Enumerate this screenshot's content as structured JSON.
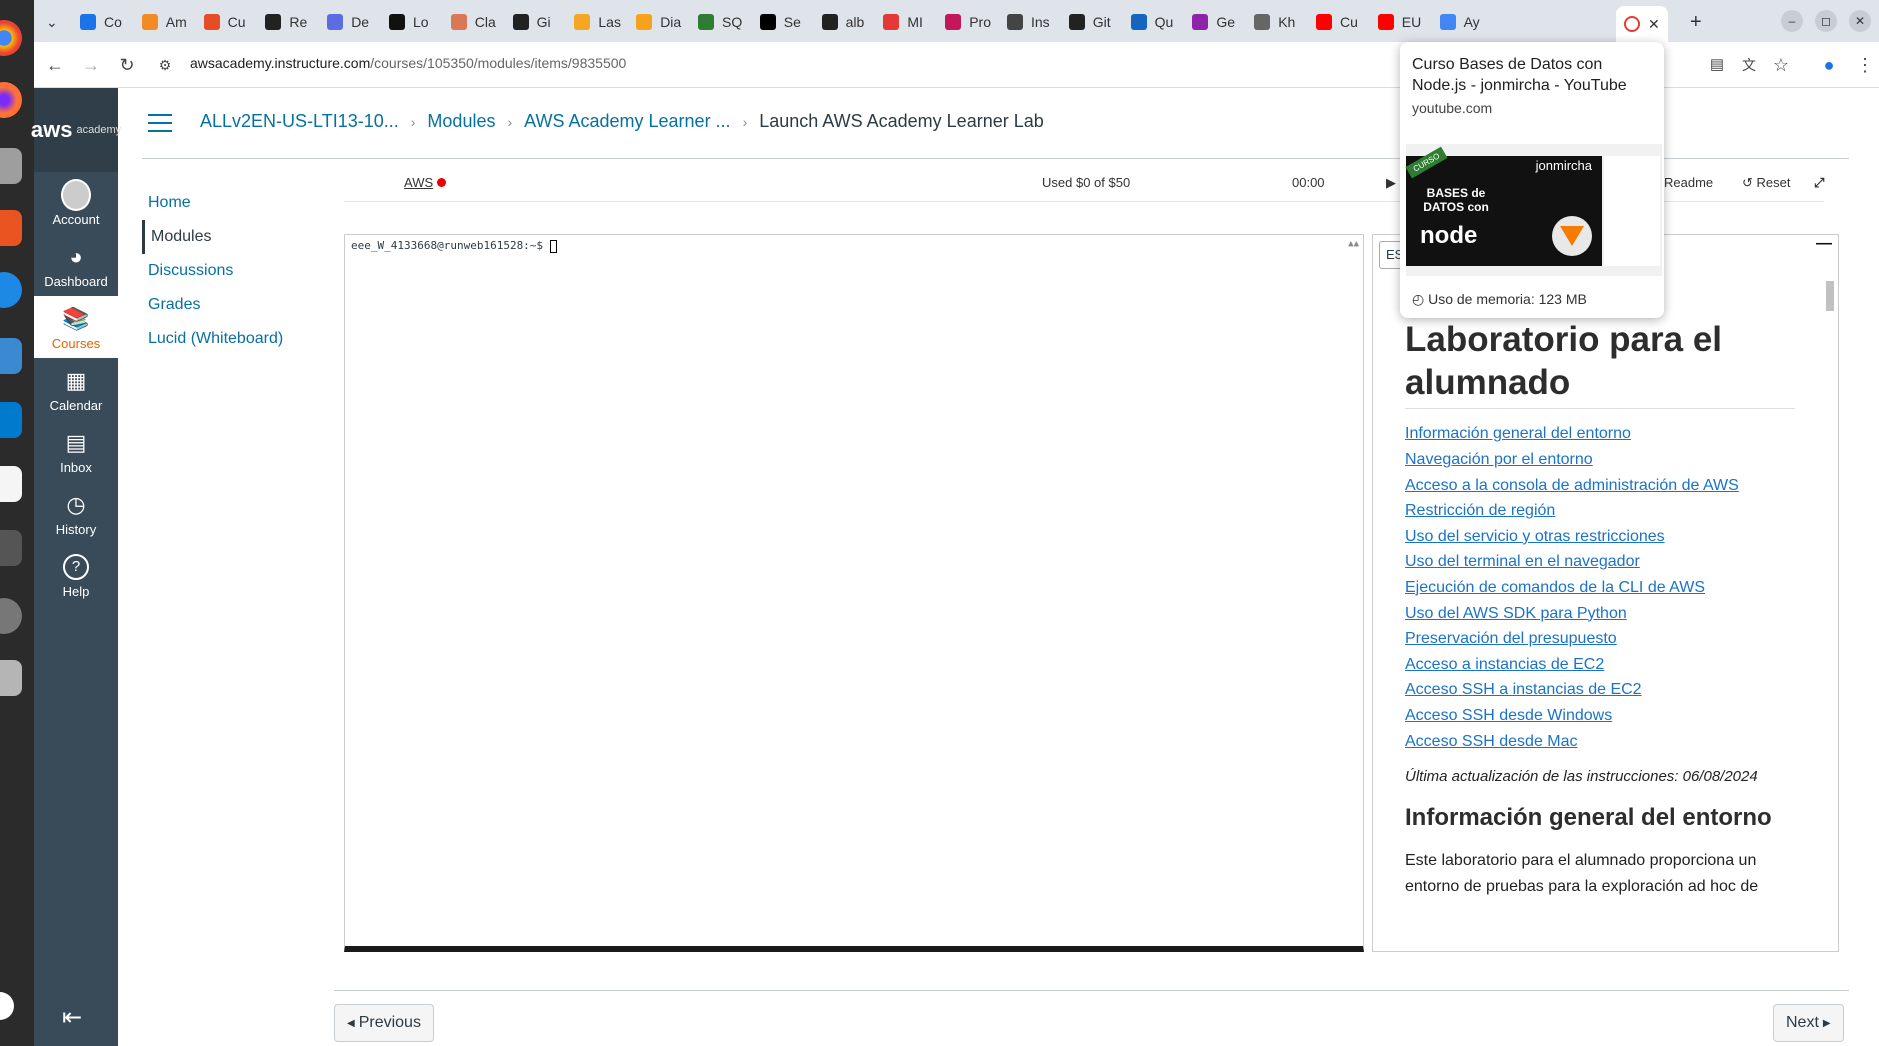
{
  "browser": {
    "tabs": [
      {
        "label": "Co",
        "color": "#1a73e8"
      },
      {
        "label": "Am",
        "color": "#f28b24"
      },
      {
        "label": "Cu",
        "color": "#e44d26"
      },
      {
        "label": "Re",
        "color": "#222222"
      },
      {
        "label": "De",
        "color": "#5b6ee1"
      },
      {
        "label": "Lo",
        "color": "#111111"
      },
      {
        "label": "Cla",
        "color": "#d97757"
      },
      {
        "label": "Gi",
        "color": "#222222"
      },
      {
        "label": "Las",
        "color": "#f5a623"
      },
      {
        "label": "Dia",
        "color": "#f7a21b"
      },
      {
        "label": "SQ",
        "color": "#2e7d32"
      },
      {
        "label": "Se",
        "color": "#000000"
      },
      {
        "label": "alb",
        "color": "#222222"
      },
      {
        "label": "MI",
        "color": "#e53935"
      },
      {
        "label": "Pro",
        "color": "#c2185b"
      },
      {
        "label": "Ins",
        "color": "#444444"
      },
      {
        "label": "Git",
        "color": "#222222"
      },
      {
        "label": "Qu",
        "color": "#1565c0"
      },
      {
        "label": "Ge",
        "color": "#8e24aa"
      },
      {
        "label": "Kh",
        "color": "#666666"
      },
      {
        "label": "Cu",
        "color": "#ff0000"
      },
      {
        "label": "EU",
        "color": "#ff0000"
      },
      {
        "label": "Ay",
        "color": "#4285f4"
      }
    ],
    "url_host": "awsacademy.instructure.com",
    "url_path": "/courses/105350/modules/items/9835500"
  },
  "hovercard": {
    "title": "Curso Bases de Datos con Node.js - jonmircha - YouTube",
    "domain": "youtube.com",
    "thumb_brand": "jonmircha",
    "thumb_text": "BASES de DATOS con",
    "thumb_node": "node",
    "thumb_badge": "CURSO",
    "memory": "Uso de memoria: 123 MB"
  },
  "globalnav": {
    "logo": "aws",
    "logo_sub": "academy",
    "items": [
      {
        "label": "Account",
        "icon": "account-icon"
      },
      {
        "label": "Dashboard",
        "icon": "dashboard-icon"
      },
      {
        "label": "Courses",
        "icon": "courses-icon"
      },
      {
        "label": "Calendar",
        "icon": "calendar-icon"
      },
      {
        "label": "Inbox",
        "icon": "inbox-icon"
      },
      {
        "label": "History",
        "icon": "history-icon"
      },
      {
        "label": "Help",
        "icon": "help-icon"
      }
    ]
  },
  "breadcrumb": {
    "course": "ALLv2EN-US-LTI13-10...",
    "modules": "Modules",
    "module": "AWS Academy Learner ...",
    "current": "Launch AWS Academy Learner Lab"
  },
  "coursenav": [
    "Home",
    "Modules",
    "Discussions",
    "Grades",
    "Lucid (Whiteboard)"
  ],
  "labbar": {
    "aws_label": "AWS",
    "budget": "Used $0 of $50",
    "timer": "00:00",
    "start_label": "S",
    "readme_label": "Readme",
    "reset_label": "Reset"
  },
  "terminal": {
    "prompt": "eee_W_4133668@runweb161528:~$ "
  },
  "readme": {
    "lang": "ES",
    "title": "Laboratorio para el alumnado",
    "toc": [
      "Información general del entorno",
      "Navegación por el entorno",
      "Acceso a la consola de administración de AWS",
      "Restricción de región",
      "Uso del servicio y otras restricciones",
      "Uso del terminal en el navegador",
      "Ejecución de comandos de la CLI de AWS",
      "Uso del AWS SDK para Python",
      "Preservación del presupuesto",
      "Acceso a instancias de EC2",
      "Acceso SSH a instancias de EC2",
      "Acceso SSH desde Windows",
      "Acceso SSH desde Mac"
    ],
    "updated": "Última actualización de las instrucciones: 06/08/2024",
    "section_title": "Información general del entorno",
    "section_text": "Este laboratorio para el alumnado proporciona un entorno de pruebas para la exploración ad hoc de"
  },
  "pager": {
    "previous": "Previous",
    "next": "Next"
  }
}
